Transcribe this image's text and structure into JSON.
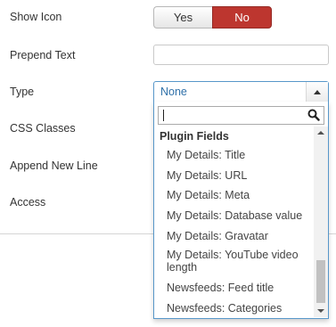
{
  "form": {
    "show_icon": {
      "label": "Show Icon",
      "yes": "Yes",
      "no": "No",
      "selected": "No"
    },
    "prepend_text": {
      "label": "Prepend Text",
      "value": ""
    },
    "type": {
      "label": "Type",
      "selected": "None",
      "dropdown": {
        "search_value": "",
        "group_label": "Plugin Fields",
        "options": [
          "My Details: Title",
          "My Details: URL",
          "My Details: Meta",
          "My Details: Database value",
          "My Details: Gravatar",
          "My Details: YouTube video length",
          "Newsfeeds: Feed title",
          "Newsfeeds: Categories"
        ],
        "scroll_position": 0.75
      }
    },
    "css_classes": {
      "label": "CSS Classes"
    },
    "append_new_line": {
      "label": "Append New Line"
    },
    "access": {
      "label": "Access"
    }
  },
  "colors": {
    "toggle_active": "#bd362f",
    "select_border": "#5897c9",
    "select_value": "#3071a9"
  }
}
